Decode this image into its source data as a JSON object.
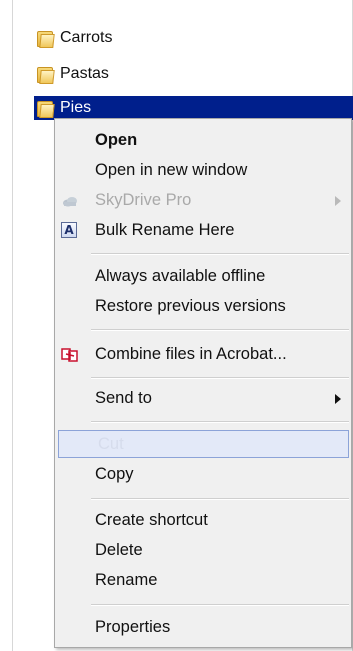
{
  "files": [
    {
      "name": "Carrots",
      "icon": "folder-icon",
      "selected": false
    },
    {
      "name": "Pastas",
      "icon": "folder-icon",
      "selected": false
    },
    {
      "name": "Pies",
      "icon": "folder-icon",
      "selected": true
    }
  ],
  "menu": {
    "open": "Open",
    "open_new_window": "Open in new window",
    "skydrive_pro": "SkyDrive Pro",
    "bulk_rename": "Bulk Rename Here",
    "always_offline": "Always available offline",
    "restore_versions": "Restore previous versions",
    "combine_acrobat": "Combine files in Acrobat...",
    "send_to": "Send to",
    "cut": "Cut",
    "copy": "Copy",
    "create_shortcut": "Create shortcut",
    "delete": "Delete",
    "rename": "Rename",
    "properties": "Properties"
  },
  "colors": {
    "selection": "#001f8c",
    "menu_background": "#f0f0f0",
    "hover_background": "#e3e9f8",
    "hover_border": "#8ca3d8",
    "acrobat_red": "#c8102e"
  }
}
